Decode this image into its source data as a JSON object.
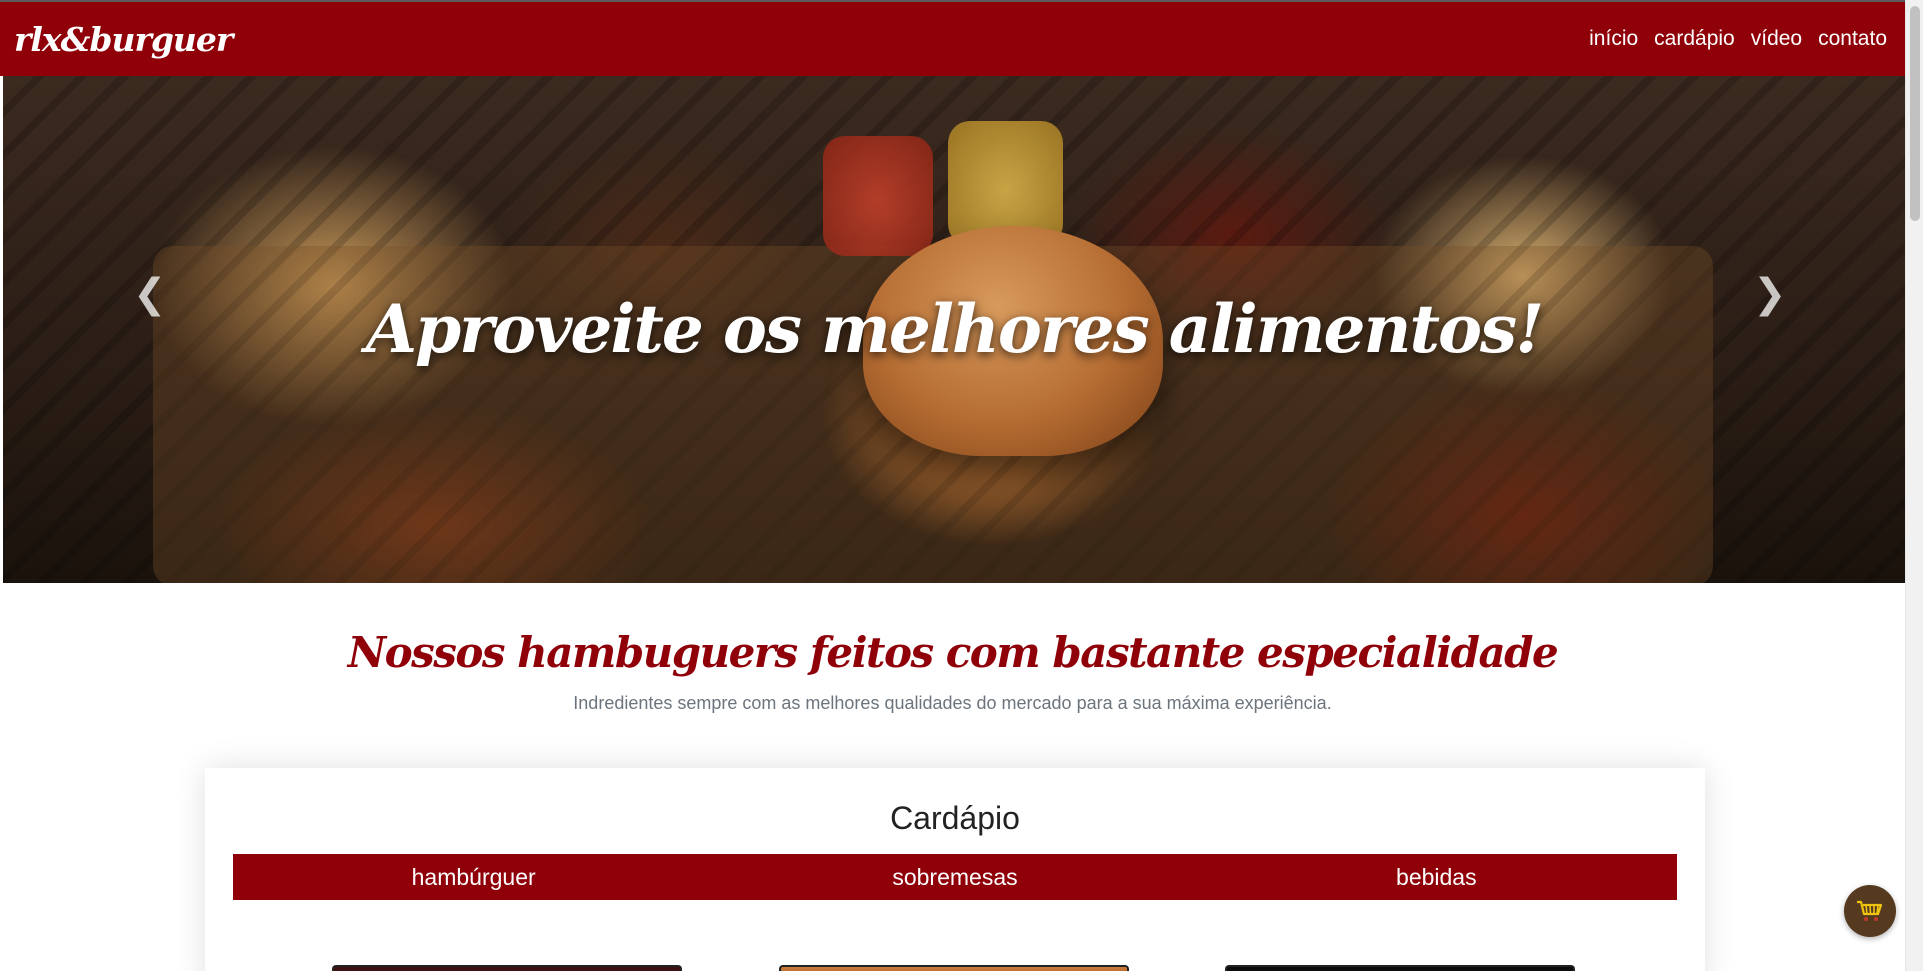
{
  "brand": {
    "logo": "rlx&burguer"
  },
  "nav": {
    "items": [
      {
        "label": "início"
      },
      {
        "label": "cardápio"
      },
      {
        "label": "vídeo"
      },
      {
        "label": "contato"
      }
    ]
  },
  "hero": {
    "title": "Aproveite os melhores alimentos!",
    "prev_icon": "chevron-left-icon",
    "next_icon": "chevron-right-icon"
  },
  "section": {
    "title": "Nossos hambuguers feitos com bastante especialidade",
    "subtitle": "Indredientes sempre com as melhores qualidades do mercado para a sua máxima experiência."
  },
  "menu": {
    "title": "Cardápio",
    "tabs": [
      {
        "label": "hambúrguer"
      },
      {
        "label": "sobremesas"
      },
      {
        "label": "bebidas"
      }
    ]
  },
  "cart": {
    "icon": "shopping-cart-icon"
  },
  "colors": {
    "brand": "#8f0009",
    "cart_button": "#553a1f",
    "cart_icon": "#f1c40f"
  }
}
